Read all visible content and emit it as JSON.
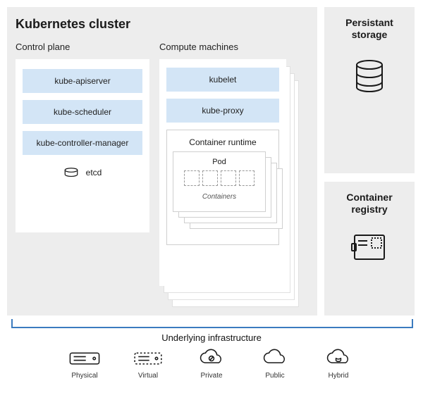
{
  "cluster": {
    "title": "Kubernetes cluster",
    "control_plane": {
      "heading": "Control plane",
      "components": [
        "kube-apiserver",
        "kube-scheduler",
        "kube-controller-manager"
      ],
      "etcd_label": "etcd"
    },
    "compute": {
      "heading": "Compute machines",
      "components": [
        "kubelet",
        "kube-proxy"
      ],
      "runtime": {
        "title": "Container runtime",
        "pod_label": "Pod",
        "containers_label": "Containers",
        "container_count": 4
      },
      "replica_hint": "stack of 4"
    }
  },
  "side": {
    "storage": {
      "title_line1": "Persistant",
      "title_line2": "storage"
    },
    "registry": {
      "title_line1": "Container",
      "title_line2": "registry"
    }
  },
  "infra": {
    "title": "Underlying infrastructure",
    "items": [
      {
        "label": "Physical",
        "icon": "physical"
      },
      {
        "label": "Virtual",
        "icon": "virtual"
      },
      {
        "label": "Private",
        "icon": "private"
      },
      {
        "label": "Public",
        "icon": "public"
      },
      {
        "label": "Hybrid",
        "icon": "hybrid"
      }
    ]
  },
  "colors": {
    "panel_bg": "#ededed",
    "chip_bg": "#d3e5f6",
    "bracket": "#3b7bbf"
  }
}
